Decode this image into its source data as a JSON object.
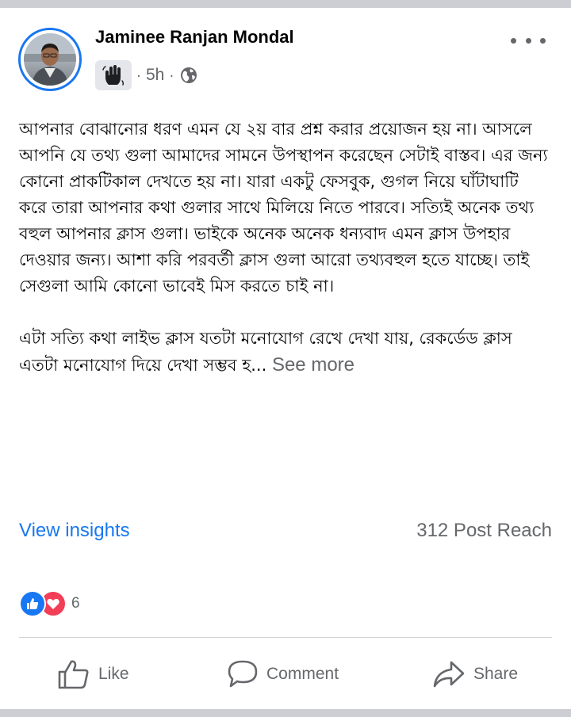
{
  "post": {
    "author": "Jaminee Ranjan Mondal",
    "time": "5h",
    "separator": "·",
    "paragraphs": [
      "আপনার বোঝানোর ধরণ এমন যে ২য় বার প্রশ্ন করার প্রয়োজন হয় না। আসলে আপনি যে তথ্য গুলা আমাদের সামনে উপস্থাপন করেছেন সেটাই বাস্তব। এর জন্য কোনো প্রাকটিকাল দেখতে হয় না। যারা একটু ফেসবুক, গুগল নিয়ে ঘাঁটাঘাটি করে তারা আপনার কথা গুলার সাথে মিলিয়ে নিতে পারবে। সত্যিই অনেক তথ্য বহুল আপনার ক্লাস গুলা। ভাইকে অনেক অনেক ধন্যবাদ এমন ক্লাস উপহার দেওয়ার জন্য। আশা করি পরবর্তী ক্লাস গুলা আরো তথ্যবহুল হতে যাচ্ছে। তাই সেগুলা আমি কোনো ভাবেই মিস করতে চাই না।",
      "এটা সত্যি কথা লাইভ ক্লাস যতটা মনোযোগ রেখে দেখা যায়, রেকর্ডেড ক্লাস এতটা মনোযোগ দিয়ে দেখা সম্ভব হ..."
    ],
    "see_more": "See more"
  },
  "insights": {
    "view_label": "View insights",
    "reach": "312 Post Reach"
  },
  "reactions": {
    "count": "6",
    "types": [
      "like-icon",
      "love-icon"
    ]
  },
  "actions": {
    "like": "Like",
    "comment": "Comment",
    "share": "Share"
  },
  "colors": {
    "accent": "#1877f2",
    "secondary_text": "#65676b",
    "love": "#f33e58",
    "separator_bar": "#ccced3"
  }
}
